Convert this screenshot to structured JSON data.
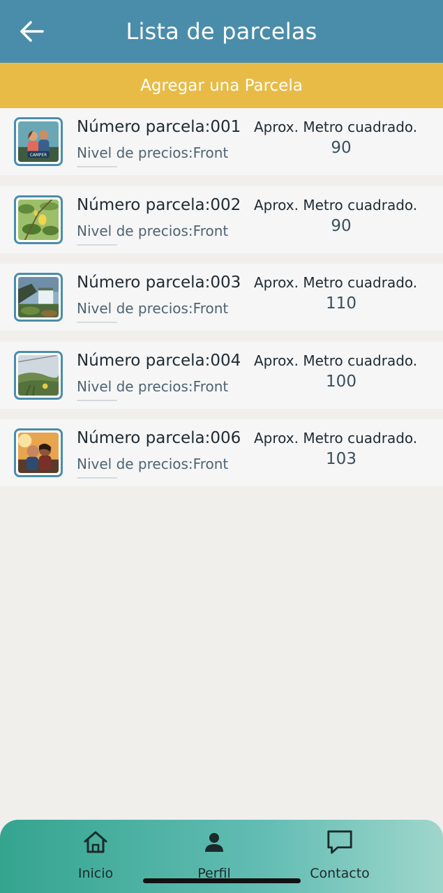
{
  "header": {
    "title": "Lista de parcelas",
    "back_icon": "arrow-left-icon"
  },
  "add_button": {
    "label": "Agregar una Parcela"
  },
  "parcels": [
    {
      "title": "Número parcela:001",
      "price_level": "Nivel de precios:Front",
      "area_label": "Aprox. Metro cuadrado.",
      "area_value": "90"
    },
    {
      "title": "Número parcela:002",
      "price_level": "Nivel de precios:Front",
      "area_label": "Aprox. Metro cuadrado.",
      "area_value": "90"
    },
    {
      "title": "Número parcela:003",
      "price_level": "Nivel de precios:Front",
      "area_label": "Aprox. Metro cuadrado.",
      "area_value": "110"
    },
    {
      "title": "Número parcela:004",
      "price_level": "Nivel de precios:Front",
      "area_label": "Aprox. Metro cuadrado.",
      "area_value": "100"
    },
    {
      "title": "Número parcela:006",
      "price_level": "Nivel de precios:Front",
      "area_label": "Aprox. Metro cuadrado.",
      "area_value": "103"
    }
  ],
  "nav": {
    "inicio": {
      "label": "Inicio",
      "icon": "home-icon"
    },
    "perfil": {
      "label": "Perfil",
      "icon": "person-icon"
    },
    "contacto": {
      "label": "Contacto",
      "icon": "chat-bubble-icon"
    }
  },
  "colors": {
    "header": "#4a8daa",
    "add_button": "#e8bb47",
    "nav_gradient_start": "#34a48f",
    "nav_gradient_end": "#9fd6cb"
  }
}
